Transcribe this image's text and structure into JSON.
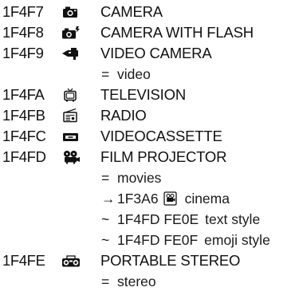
{
  "entries": [
    {
      "code": "1F4F7",
      "name": "CAMERA",
      "icon": "camera-icon"
    },
    {
      "code": "1F4F8",
      "name": "CAMERA WITH FLASH",
      "icon": "camera-with-flash-icon"
    },
    {
      "code": "1F4F9",
      "name": "VIDEO CAMERA",
      "icon": "video-camera-icon",
      "notes": [
        {
          "symbol": "=",
          "text": "video"
        }
      ]
    },
    {
      "code": "1F4FA",
      "name": "TELEVISION",
      "icon": "television-icon"
    },
    {
      "code": "1F4FB",
      "name": "RADIO",
      "icon": "radio-icon"
    },
    {
      "code": "1F4FC",
      "name": "VIDEOCASSETTE",
      "icon": "videocassette-icon"
    },
    {
      "code": "1F4FD",
      "name": "FILM PROJECTOR",
      "icon": "film-projector-icon",
      "notes": [
        {
          "symbol": "=",
          "text": "movies"
        },
        {
          "symbol": "→",
          "code": "1F3A6",
          "icon": "cinema-icon",
          "text": "cinema"
        },
        {
          "symbol": "~",
          "code": "1F4FD FE0E",
          "text": "text style"
        },
        {
          "symbol": "~",
          "code": "1F4FD FE0F",
          "text": "emoji style"
        }
      ]
    },
    {
      "code": "1F4FE",
      "name": "PORTABLE STEREO",
      "icon": "portable-stereo-icon",
      "notes": [
        {
          "symbol": "=",
          "text": "stereo"
        }
      ]
    }
  ]
}
